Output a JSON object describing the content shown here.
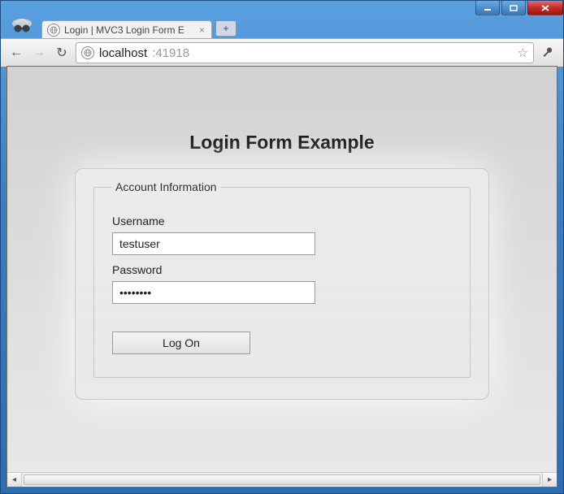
{
  "window": {
    "buttons": {
      "minimize": "min",
      "maximize": "max",
      "close": "close"
    }
  },
  "browser": {
    "tab": {
      "title": "Login | MVC3 Login Form E",
      "favicon": "globe"
    },
    "newtab_label": "+",
    "nav": {
      "back": "←",
      "forward": "→",
      "reload": "↻"
    },
    "url": {
      "host": "localhost",
      "port": ":41918"
    }
  },
  "page": {
    "title": "Login Form Example",
    "fieldset_legend": "Account Information",
    "username": {
      "label": "Username",
      "value": "testuser"
    },
    "password": {
      "label": "Password",
      "value": "password"
    },
    "submit_label": "Log On"
  }
}
